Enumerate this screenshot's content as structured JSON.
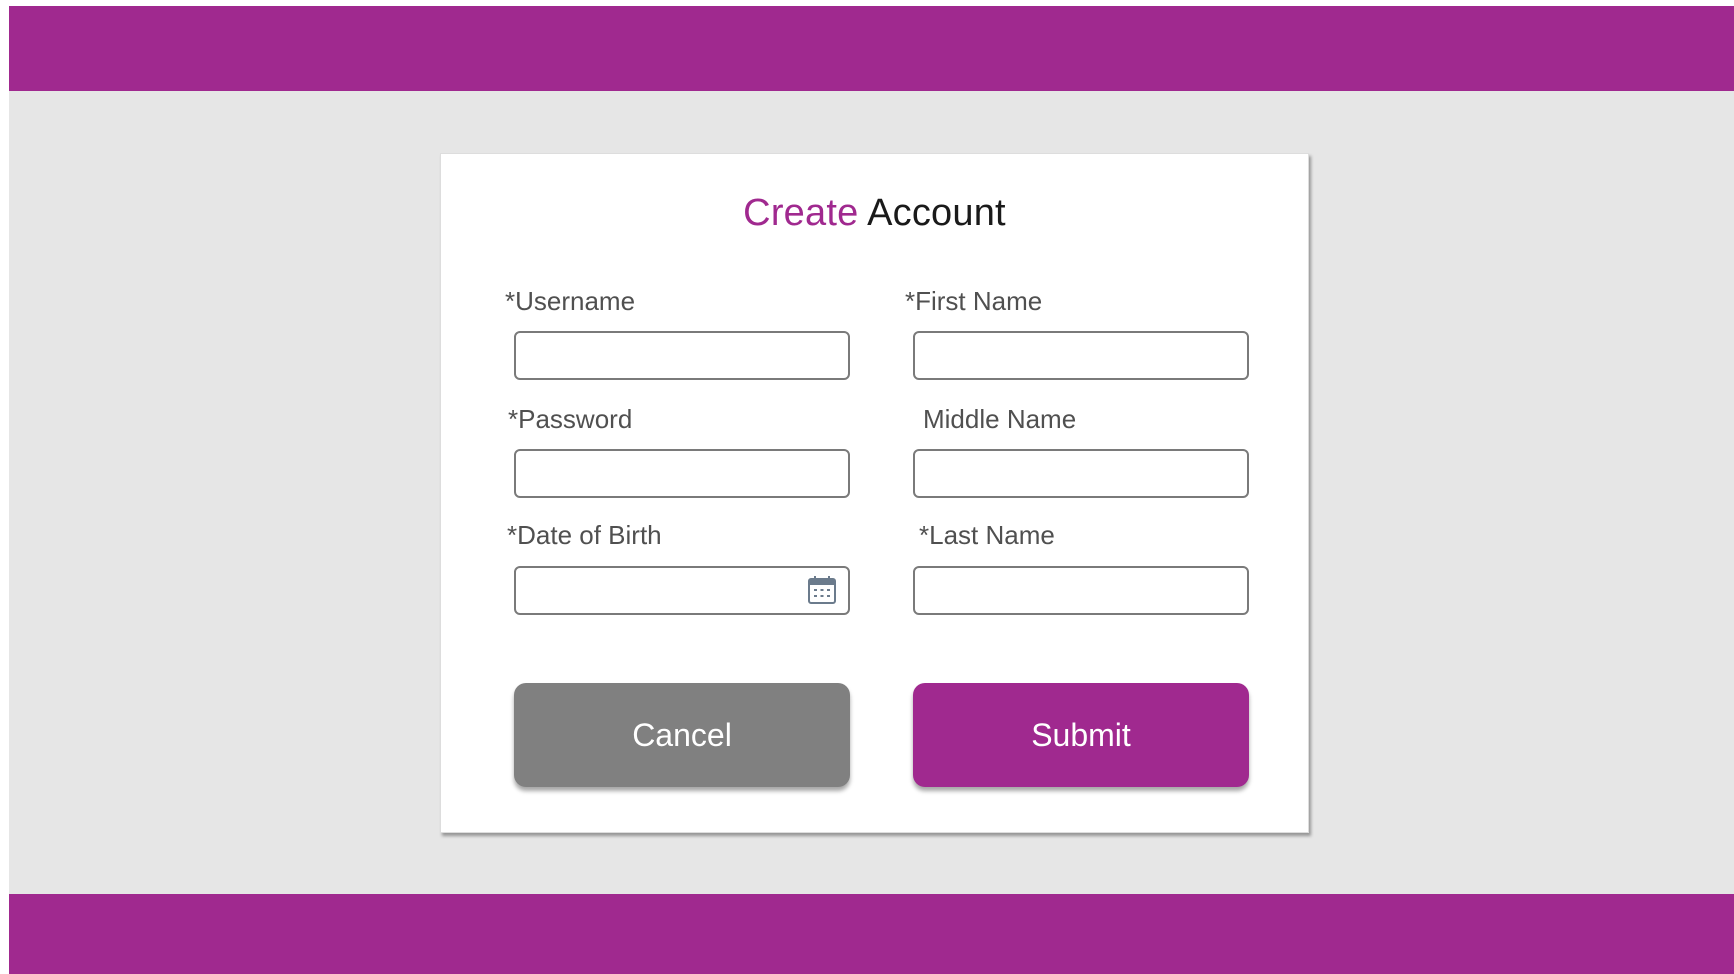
{
  "colors": {
    "brand": "#a0298f",
    "background": "#e6e6e6",
    "cancel": "#808080"
  },
  "form": {
    "title_accent": "Create",
    "title_rest": " Account",
    "fields": {
      "username": {
        "label": "*Username",
        "value": ""
      },
      "first_name": {
        "label": "*First Name",
        "value": ""
      },
      "password": {
        "label": "*Password",
        "value": ""
      },
      "middle_name": {
        "label": "Middle Name",
        "value": ""
      },
      "date_of_birth": {
        "label": "*Date of Birth",
        "value": "",
        "icon": "calendar-icon"
      },
      "last_name": {
        "label": "*Last Name",
        "value": ""
      }
    },
    "cancel_label": "Cancel",
    "submit_label": "Submit"
  }
}
